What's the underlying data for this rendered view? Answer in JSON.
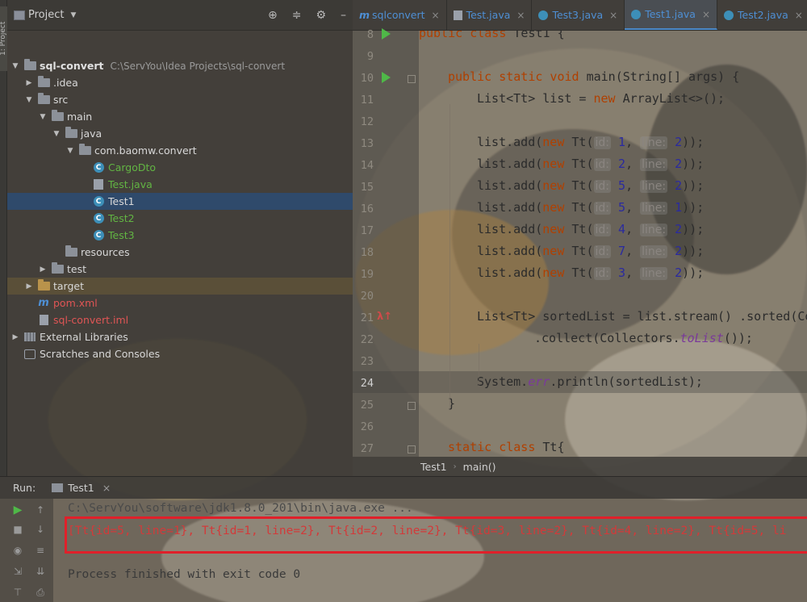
{
  "project_panel": {
    "title": "Project",
    "tree": [
      {
        "label": "sql-convert",
        "extra": "C:\\ServYou\\Idea Projects\\sql-convert",
        "depth": 0,
        "arrow": "down",
        "icon": "module-folder-icon",
        "style": "bold"
      },
      {
        "label": ".idea",
        "depth": 1,
        "arrow": "right",
        "icon": "folder-icon",
        "style": "white"
      },
      {
        "label": "src",
        "depth": 1,
        "arrow": "down",
        "icon": "folder-icon",
        "style": "white"
      },
      {
        "label": "main",
        "depth": 2,
        "arrow": "down",
        "icon": "folder-icon",
        "style": "white"
      },
      {
        "label": "java",
        "depth": 3,
        "arrow": "down",
        "icon": "source-folder-icon",
        "style": "white"
      },
      {
        "label": "com.baomw.convert",
        "depth": 4,
        "arrow": "down",
        "icon": "package-icon",
        "style": "white"
      },
      {
        "label": "CargoDto",
        "depth": 5,
        "arrow": "",
        "icon": "class-icon",
        "style": "green"
      },
      {
        "label": "Test.java",
        "depth": 5,
        "arrow": "",
        "icon": "java-file-icon",
        "style": "green"
      },
      {
        "label": "Test1",
        "depth": 5,
        "arrow": "",
        "icon": "runnable-class-icon",
        "style": "white",
        "selected": true
      },
      {
        "label": "Test2",
        "depth": 5,
        "arrow": "",
        "icon": "runnable-class-icon",
        "style": "green"
      },
      {
        "label": "Test3",
        "depth": 5,
        "arrow": "",
        "icon": "runnable-class-icon",
        "style": "green"
      },
      {
        "label": "resources",
        "depth": 3,
        "arrow": "",
        "icon": "resources-folder-icon",
        "style": "white"
      },
      {
        "label": "test",
        "depth": 2,
        "arrow": "right",
        "icon": "folder-icon",
        "style": "white"
      },
      {
        "label": "target",
        "depth": 1,
        "arrow": "right",
        "icon": "excluded-folder-icon",
        "style": "white",
        "highlight": true
      },
      {
        "label": "pom.xml",
        "depth": 1,
        "arrow": "",
        "icon": "maven-icon",
        "style": "red"
      },
      {
        "label": "sql-convert.iml",
        "depth": 1,
        "arrow": "",
        "icon": "iml-file-icon",
        "style": "red"
      },
      {
        "label": "External Libraries",
        "depth": 0,
        "arrow": "right",
        "icon": "library-icon",
        "style": "white"
      },
      {
        "label": "Scratches and Consoles",
        "depth": 0,
        "arrow": "",
        "icon": "scratches-icon",
        "style": "white"
      }
    ]
  },
  "tabs": [
    {
      "label": "sqlconvert",
      "icon": "maven-icon",
      "active": false
    },
    {
      "label": "Test.java",
      "icon": "java-file-icon",
      "active": false
    },
    {
      "label": "Test3.java",
      "icon": "class-icon",
      "active": false
    },
    {
      "label": "Test1.java",
      "icon": "class-icon",
      "active": true
    },
    {
      "label": "Test2.java",
      "icon": "class-icon",
      "active": false
    }
  ],
  "editor": {
    "line_numbers": [
      "8",
      "9",
      "10",
      "11",
      "12",
      "13",
      "14",
      "15",
      "16",
      "17",
      "18",
      "19",
      "20",
      "21",
      "22",
      "23",
      "24",
      "25",
      "26",
      "27"
    ],
    "current_line": "24",
    "code": {
      "l8": [
        "public class ",
        "Test1 {"
      ],
      "l10": [
        "public static void ",
        "main",
        "(String[] args) {"
      ],
      "l11": [
        "List<Tt> list = ",
        "new ",
        "ArrayList<>();"
      ],
      "adds": [
        {
          "id": "1",
          "line": "2"
        },
        {
          "id": "2",
          "line": "2"
        },
        {
          "id": "5",
          "line": "2"
        },
        {
          "id": "5",
          "line": "1"
        },
        {
          "id": "4",
          "line": "2"
        },
        {
          "id": "7",
          "line": "2"
        },
        {
          "id": "3",
          "line": "2"
        }
      ],
      "add_prefix": "list.add(",
      "add_new": "new ",
      "add_tt": "Tt(",
      "hint_id": "id:",
      "hint_line": "line:",
      "add_suffix": "));",
      "l21": "List<Tt> sortedList = list.stream() .sorted(Co",
      "l22a": ".collect(Collectors.",
      "l22b": "toList",
      "l22c": "());",
      "l24a": "System.",
      "l24b": "err",
      "l24c": ".println(sortedList);",
      "l25": "}",
      "l27a": "static class ",
      "l27b": "Tt{"
    }
  },
  "breadcrumb": {
    "items": [
      "Test1",
      "main()"
    ]
  },
  "run": {
    "label": "Run:",
    "tab": "Test1",
    "cmd": "C:\\ServYou\\software\\jdk1.8.0_201\\bin\\java.exe ...",
    "output": "[Tt{id=5, line=1}, Tt{id=1, line=2}, Tt{id=2, line=2}, Tt{id=3, line=2}, Tt{id=4, line=2}, Tt{id=5, li",
    "exit": "Process finished with exit code 0"
  },
  "side_strip_label": "1: Project"
}
